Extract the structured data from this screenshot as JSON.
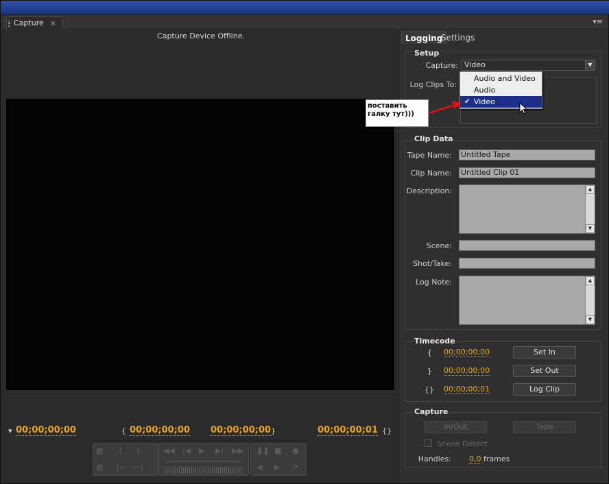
{
  "window": {
    "tab_label": "Capture",
    "tab_close": "×",
    "panel_menu": "▾≡"
  },
  "monitor": {
    "status": "Capture Device Offline.",
    "timecodes": {
      "current": "00;00;00;00",
      "in": "00;00;00;00",
      "out": "00;00;00;00",
      "duration": "00;00;00;01"
    },
    "glyphs": {
      "in_mark": "{",
      "out_mark": "}",
      "dur_mark": "{}"
    }
  },
  "right_tabs": {
    "logging": "Logging",
    "settings": "Settings"
  },
  "setup": {
    "title": "Setup",
    "capture_label": "Capture:",
    "capture_value": "Video",
    "log_clips_label": "Log Clips To:",
    "menu_items": [
      "Audio and Video",
      "Audio",
      "Video"
    ],
    "selected_index": 2
  },
  "annotation": {
    "line1": "поставить",
    "line2": "галку тут)))"
  },
  "clip_data": {
    "title": "Clip Data",
    "tape_name_label": "Tape Name:",
    "tape_name_value": "Untitled Tape",
    "clip_name_label": "Clip Name:",
    "clip_name_value": "Untitled Clip 01",
    "description_label": "Description:",
    "scene_label": "Scene:",
    "shot_take_label": "Shot/Take:",
    "log_note_label": "Log Note:"
  },
  "timecode": {
    "title": "Timecode",
    "in_value": "00;00;00;00",
    "out_value": "00;00;00;00",
    "dur_value": "00;00;00;01",
    "set_in": "Set In",
    "set_out": "Set Out",
    "log_clip": "Log Clip"
  },
  "capture_group": {
    "title": "Capture",
    "in_out": "In/Out",
    "tape": "Tape",
    "scene_detect": "Scene Detect",
    "handles_label": "Handles:",
    "handles_value": "0,0",
    "frames_label": "frames"
  },
  "colors": {
    "accent": "#e8a51c",
    "menu_selection": "#1b2f8a",
    "arrow": "#e01010"
  }
}
